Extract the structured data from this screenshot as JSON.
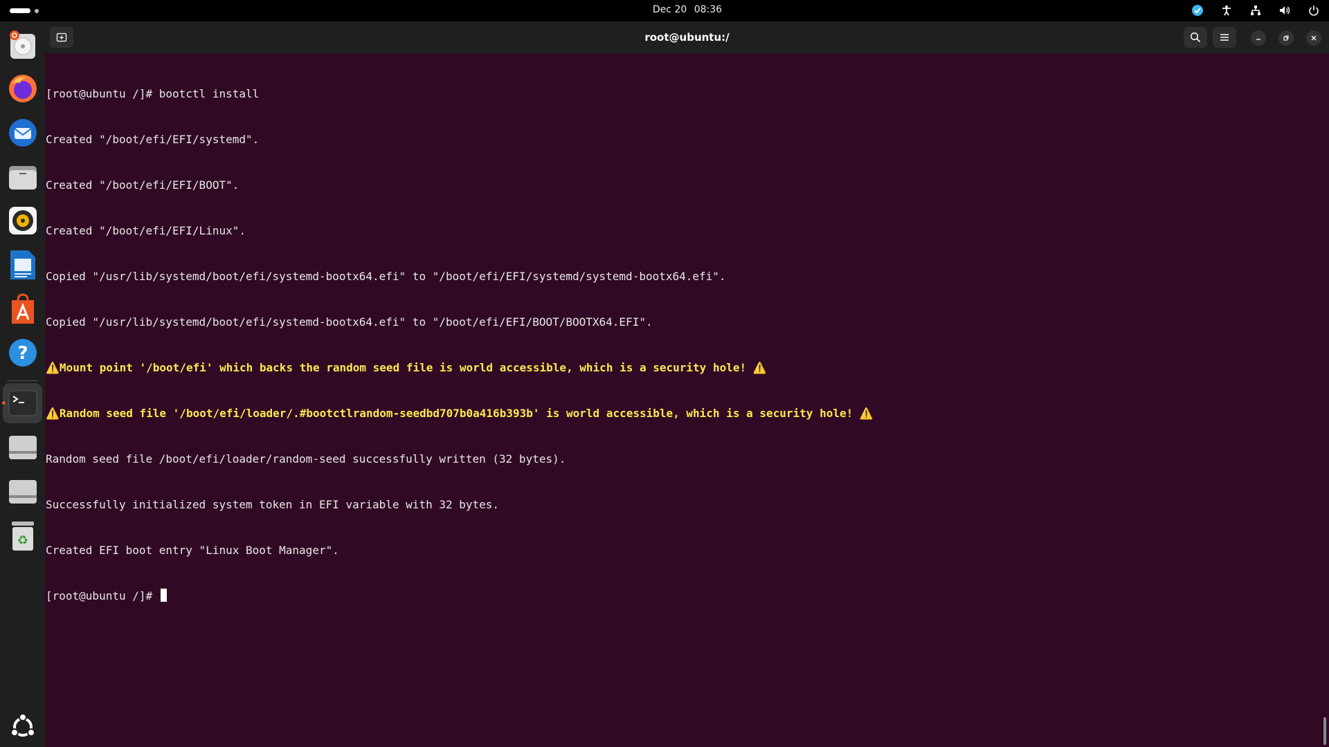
{
  "topbar": {
    "date": "Dec 20",
    "time": "08:36",
    "tray_icons": [
      "vpn-icon",
      "accessibility-icon",
      "network-icon",
      "volume-icon",
      "power-icon"
    ]
  },
  "dock": {
    "items": [
      "ubuntu-installer-icon",
      "firefox-icon",
      "thunderbird-icon",
      "files-icon",
      "rhythmbox-icon",
      "writer-icon",
      "app-center-icon",
      "help-icon",
      "terminal-icon",
      "drive-icon",
      "drive-icon",
      "trash-icon",
      "show-apps-icon"
    ]
  },
  "window": {
    "title": "root@ubuntu:/"
  },
  "terminal": {
    "lines": [
      {
        "text": "[root@ubuntu /]# bootctl install",
        "type": "normal"
      },
      {
        "text": "Created \"/boot/efi/EFI/systemd\".",
        "type": "normal"
      },
      {
        "text": "Created \"/boot/efi/EFI/BOOT\".",
        "type": "normal"
      },
      {
        "text": "Created \"/boot/efi/EFI/Linux\".",
        "type": "normal"
      },
      {
        "text": "Copied \"/usr/lib/systemd/boot/efi/systemd-bootx64.efi\" to \"/boot/efi/EFI/systemd/systemd-bootx64.efi\".",
        "type": "normal"
      },
      {
        "text": "Copied \"/usr/lib/systemd/boot/efi/systemd-bootx64.efi\" to \"/boot/efi/EFI/BOOT/BOOTX64.EFI\".",
        "type": "normal"
      },
      {
        "text": "⚠️Mount point '/boot/efi' which backs the random seed file is world accessible, which is a security hole! ⚠️",
        "type": "warn"
      },
      {
        "text": "⚠️Random seed file '/boot/efi/loader/.#bootctlrandom-seedbd707b0a416b393b' is world accessible, which is a security hole! ⚠️",
        "type": "warn"
      },
      {
        "text": "Random seed file /boot/efi/loader/random-seed successfully written (32 bytes).",
        "type": "normal"
      },
      {
        "text": "Successfully initialized system token in EFI variable with 32 bytes.",
        "type": "normal"
      },
      {
        "text": "Created EFI boot entry \"Linux Boot Manager\".",
        "type": "normal"
      }
    ],
    "prompt": "[root@ubuntu /]# "
  }
}
